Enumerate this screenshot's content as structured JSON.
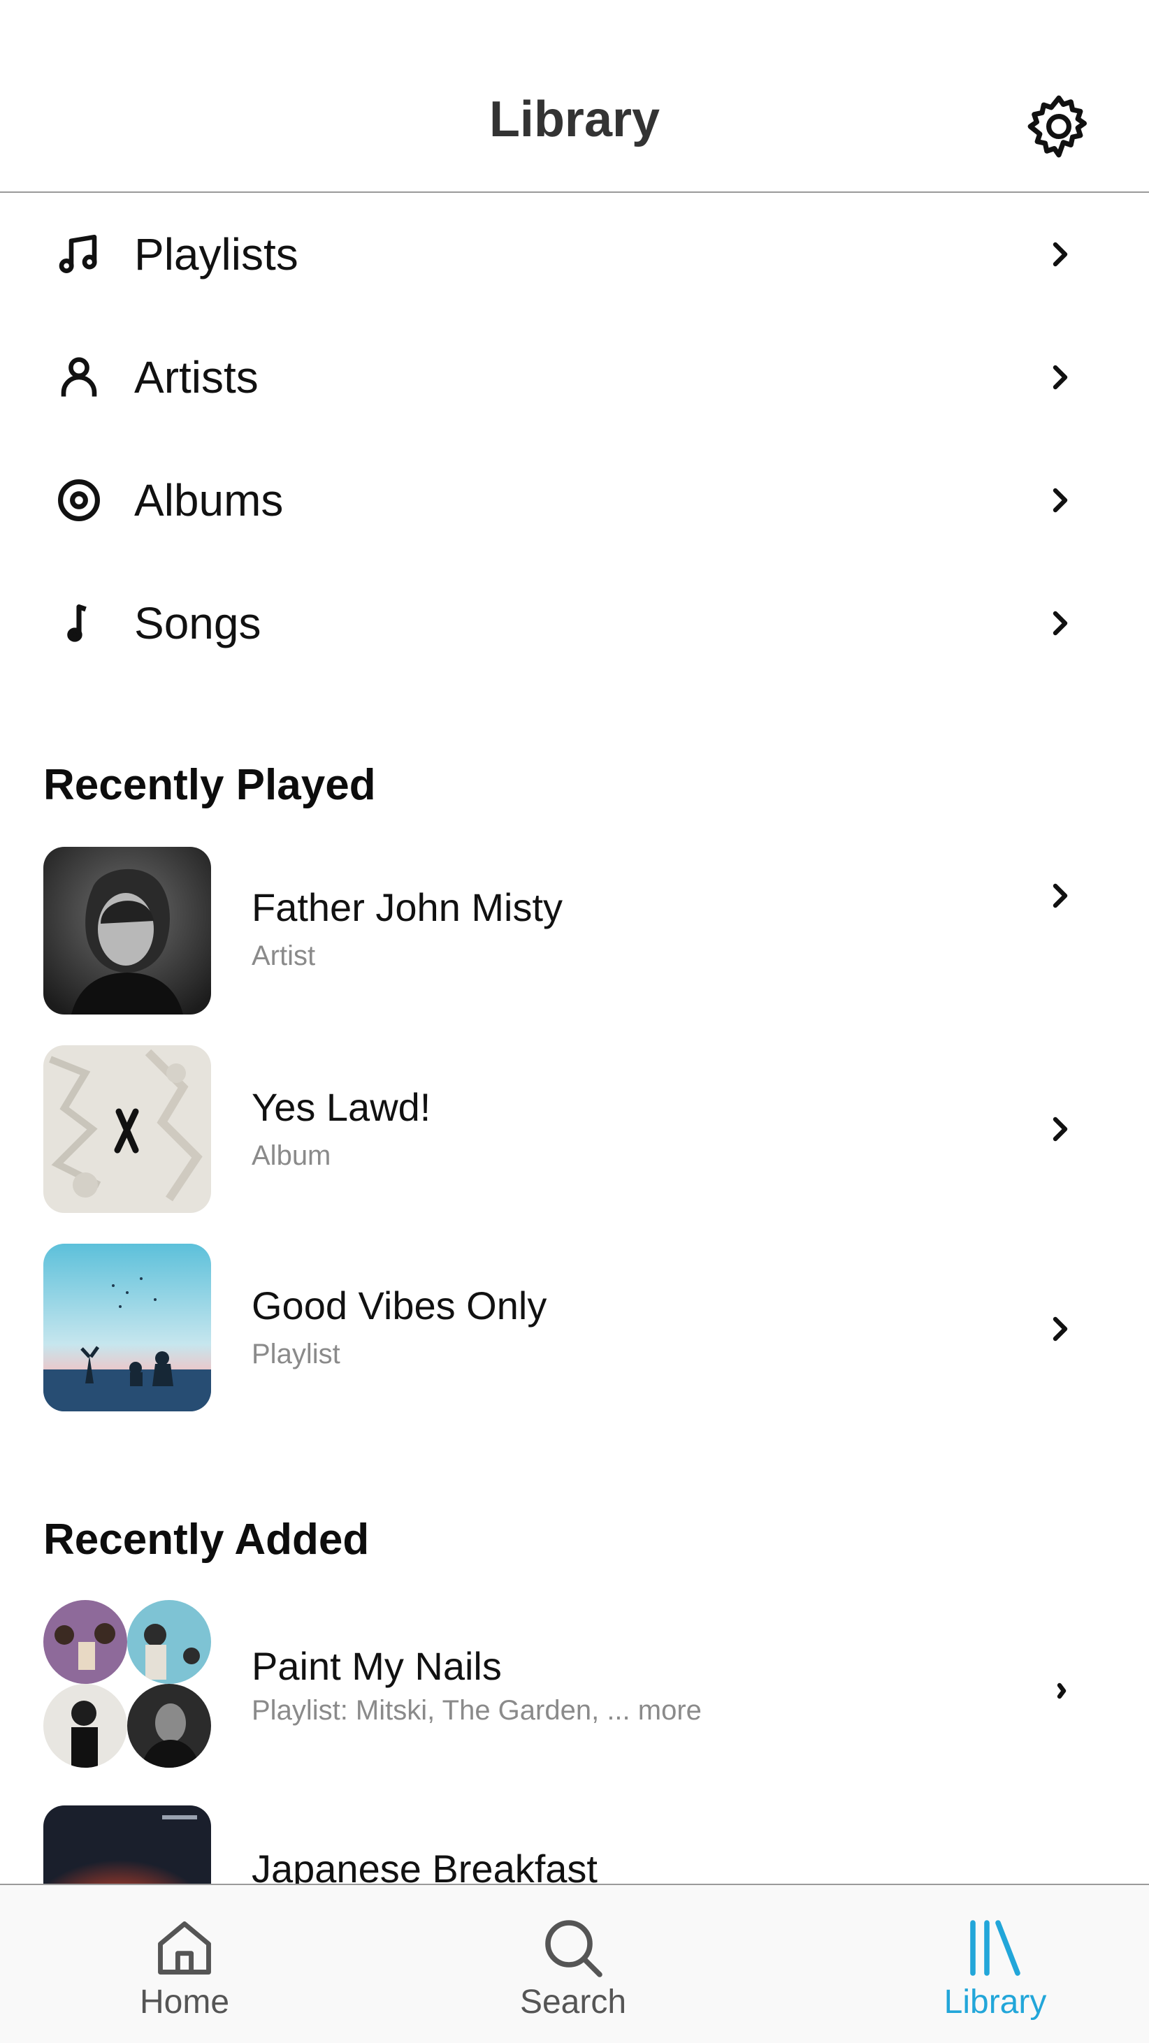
{
  "header": {
    "title": "Library",
    "settings_icon": "gear-icon"
  },
  "categories": [
    {
      "label": "Playlists",
      "icon": "music-notes-icon"
    },
    {
      "label": "Artists",
      "icon": "person-icon"
    },
    {
      "label": "Albums",
      "icon": "disc-icon"
    },
    {
      "label": "Songs",
      "icon": "music-note-icon"
    }
  ],
  "recently_played": {
    "title": "Recently Played",
    "items": [
      {
        "title": "Father John Misty",
        "subtitle": "Artist"
      },
      {
        "title": "Yes Lawd!",
        "subtitle": "Album"
      },
      {
        "title": "Good Vibes Only",
        "subtitle": "Playlist"
      }
    ]
  },
  "recently_added": {
    "title": "Recently Added",
    "items": [
      {
        "title": "Paint My Nails",
        "subtitle": "Playlist:  Mitski, The Garden,  ... more"
      },
      {
        "title": "Japanese Breakfast",
        "subtitle": ""
      }
    ]
  },
  "tabbar": {
    "tabs": [
      {
        "label": "Home",
        "icon": "home-icon",
        "active": false
      },
      {
        "label": "Search",
        "icon": "search-icon",
        "active": false
      },
      {
        "label": "Library",
        "icon": "library-icon",
        "active": true
      }
    ],
    "active_color": "#22a6d9"
  },
  "colors": {
    "accent": "#22a6d9",
    "divider": "#9a9a9a",
    "subtitle": "#8a8a8a"
  }
}
